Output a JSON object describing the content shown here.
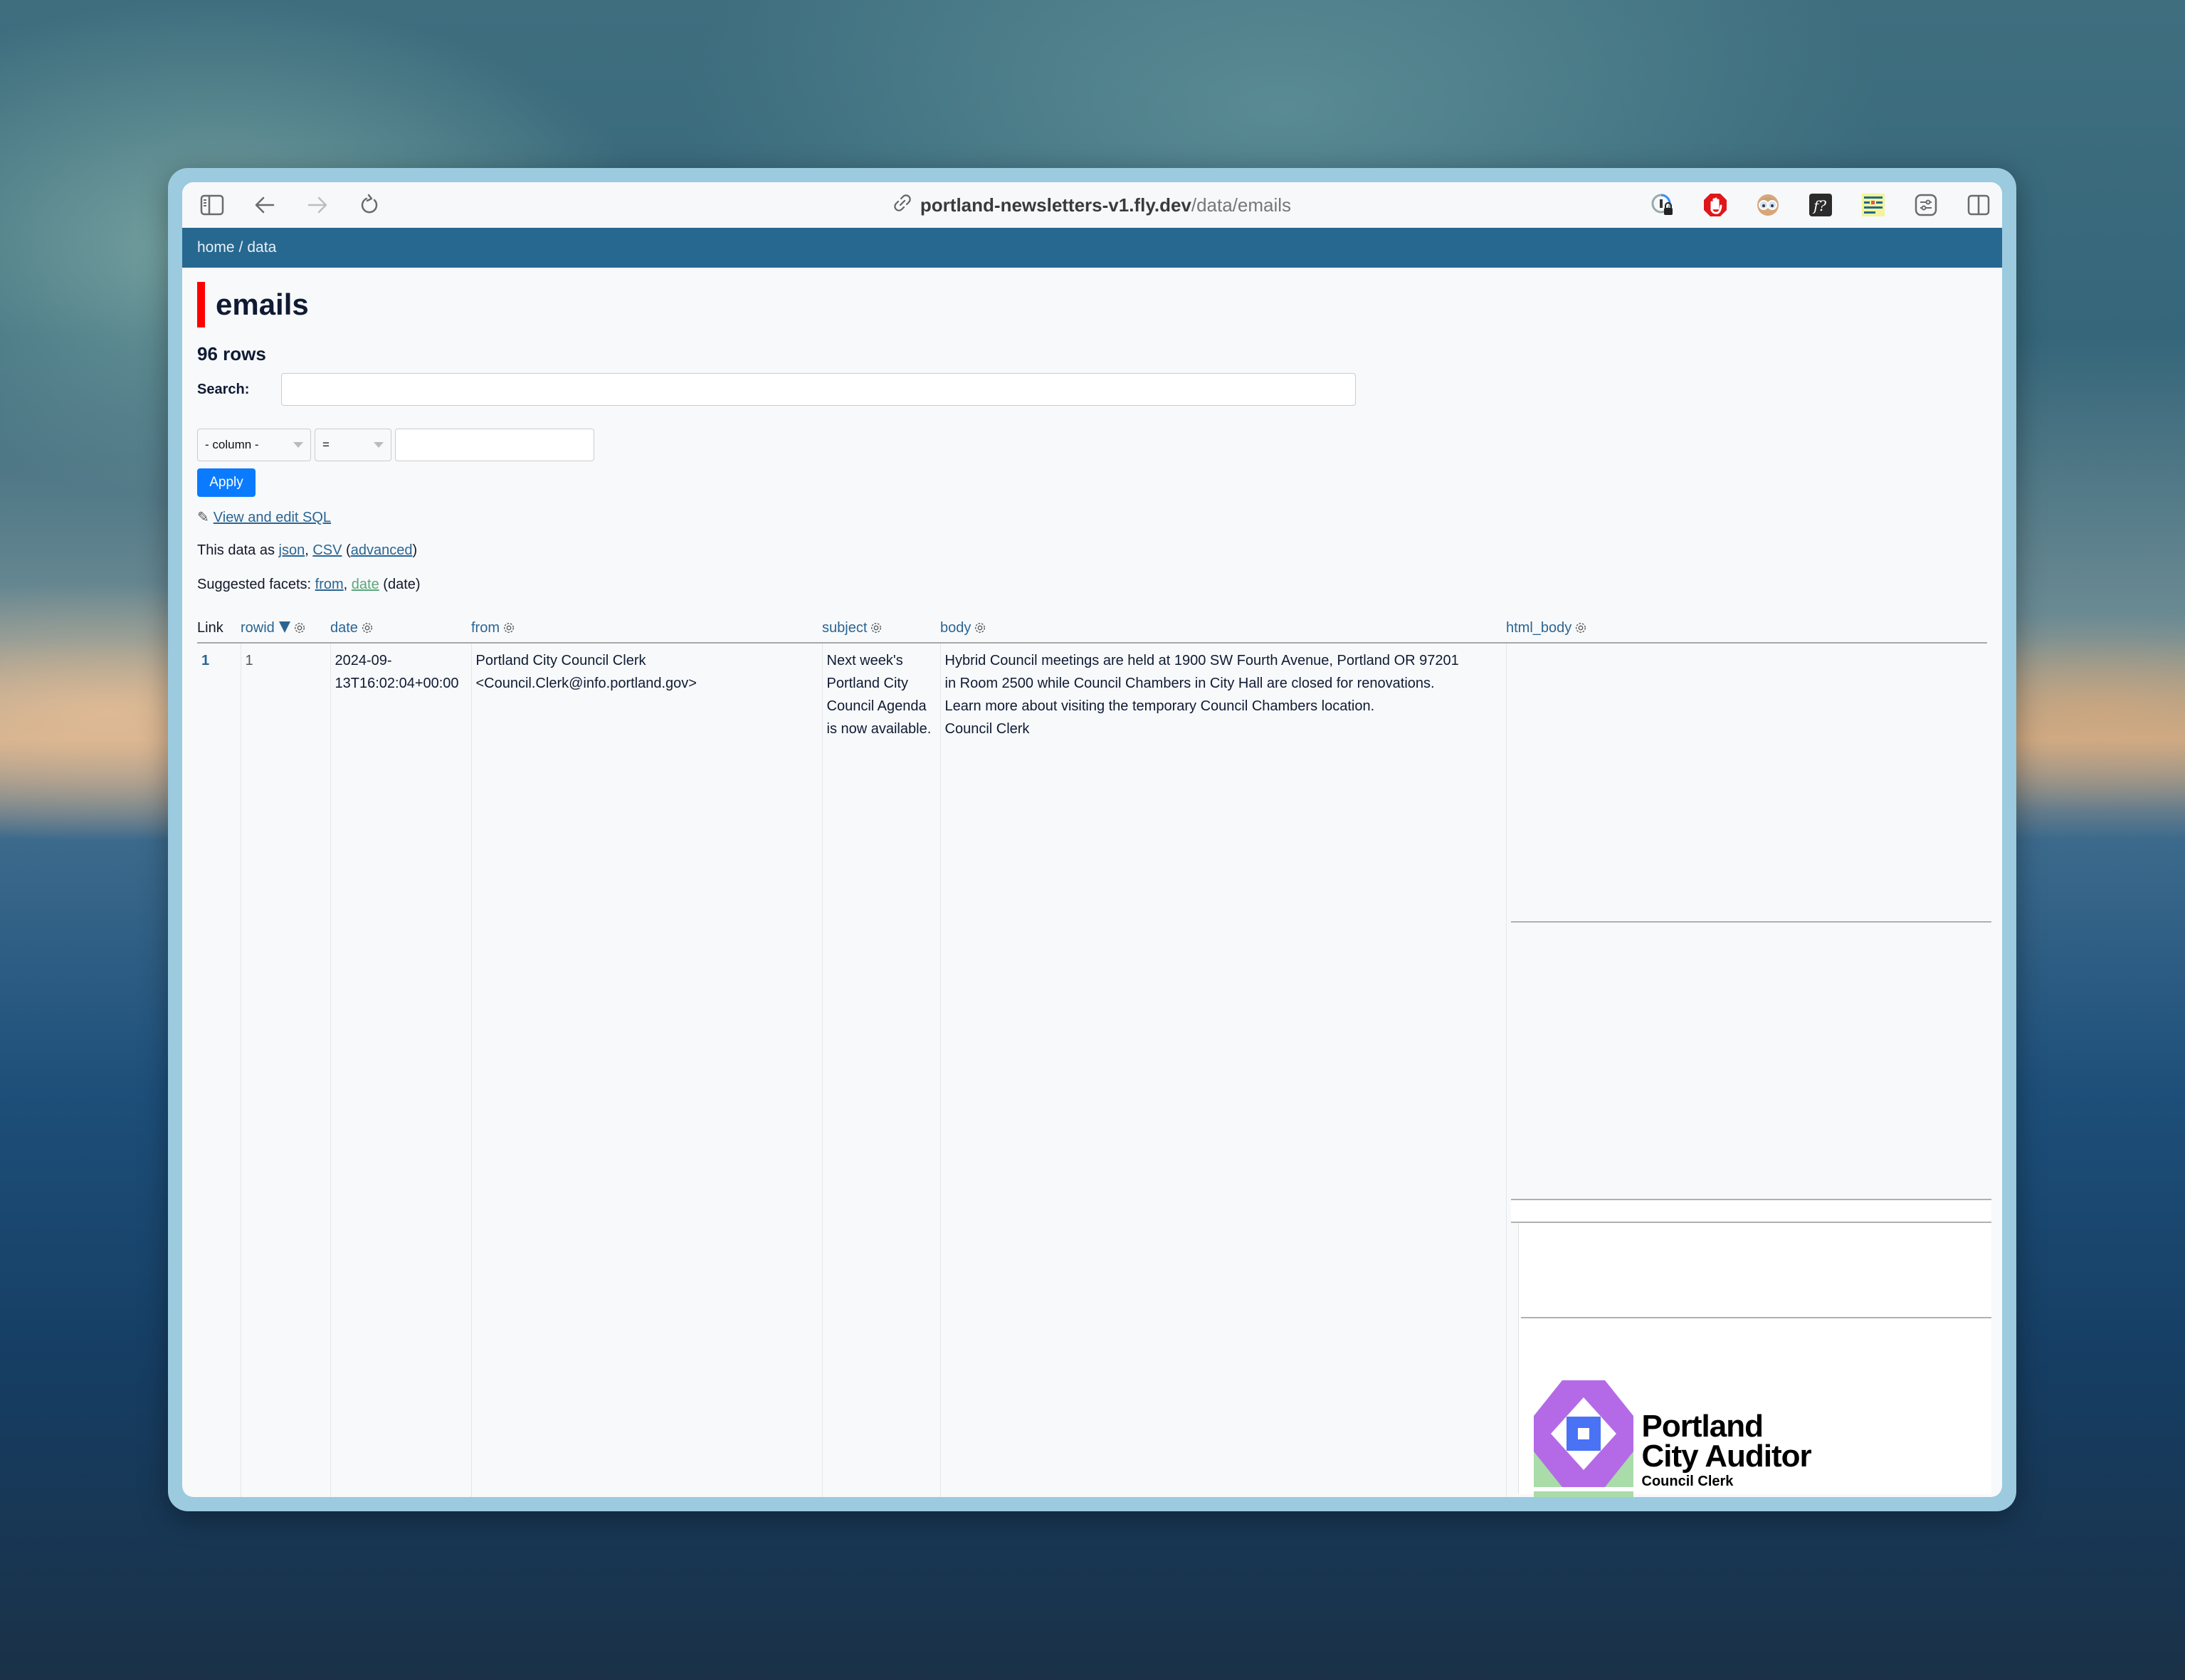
{
  "browser": {
    "url_host": "portland-newsletters-v1.fly.dev",
    "url_path": "/data/emails",
    "toolbar_icons": [
      "sidebar-icon",
      "back-icon",
      "forward-icon",
      "reload-icon"
    ],
    "extension_icons": [
      "1password-icon",
      "adblock-icon",
      "reader-glasses-icon",
      "fx-question-icon",
      "layout-bars-icon",
      "settings-sliders-icon",
      "split-view-icon"
    ]
  },
  "navbar": {
    "home": "home",
    "separator": "/",
    "data": "data"
  },
  "page": {
    "title": "emails",
    "row_count": "96 rows",
    "search_label": "Search:",
    "search_value": "",
    "filter": {
      "column_select": "- column -",
      "operator_select": "=",
      "value": ""
    },
    "apply_label": "Apply",
    "view_sql_icon": "✎",
    "view_sql_label": "View and edit SQL",
    "export": {
      "prefix": "This data as",
      "json": "json",
      "comma": ",",
      "csv": "CSV",
      "open_paren": "(",
      "advanced": "advanced",
      "close_paren": ")"
    },
    "facets": {
      "prefix": "Suggested facets:",
      "from": "from",
      "comma": ",",
      "date": "date",
      "suffix": "(date)"
    }
  },
  "table": {
    "columns": [
      {
        "label": "Link",
        "sortable": false
      },
      {
        "label": "rowid",
        "sorted": "desc"
      },
      {
        "label": "date"
      },
      {
        "label": "from"
      },
      {
        "label": "subject"
      },
      {
        "label": "body"
      },
      {
        "label": "html_body"
      }
    ],
    "rows": [
      {
        "link": "1",
        "rowid": "1",
        "date_line1": "2024-09-",
        "date_line2": "13T16:02:04+00:00",
        "from_line1": "Portland City Council Clerk",
        "from_line2": "<Council.Clerk@info.portland.gov>",
        "subject": "Next week's Portland City Council Agenda is now available.",
        "body_lines": [
          "Hybrid Council meetings are held at 1900 SW Fourth Avenue, Portland OR 97201",
          "in Room 2500 while Council Chambers in City Hall are closed for renovations.",
          "Learn more about visiting the temporary Council Chambers location.",
          "Council Clerk"
        ],
        "html_body_logo": {
          "line1": "Portland",
          "line2": "City Auditor",
          "line3": "Council Clerk"
        }
      }
    ]
  },
  "colors": {
    "navbar": "#276890",
    "title_accent": "#ff0000",
    "link": "#2a6592",
    "apply_button": "#0a7bff",
    "facet_date_link": "#5aa67c",
    "logo_purple": "#b46ae6",
    "logo_blue": "#4a72f5",
    "logo_green": "#a9dca8"
  }
}
